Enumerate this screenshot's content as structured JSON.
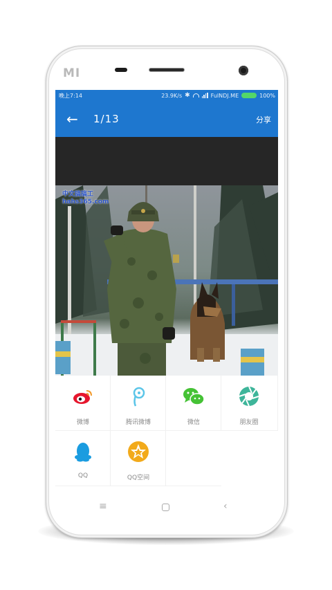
{
  "device": {
    "brand": "MI"
  },
  "status_bar": {
    "time": "晚上7:14",
    "speed": "23.9K/s",
    "carrier": "FulNDJ.ME",
    "battery": "100%"
  },
  "toolbar": {
    "back_icon": "arrow-left-icon",
    "counter": "1/13",
    "share_label": "分享"
  },
  "image": {
    "watermark_line1": "中文搞搞工",
    "watermark_line2": "hahs365.com"
  },
  "share_targets": [
    {
      "label": "微博",
      "icon": "weibo-icon",
      "color": "#e6162d"
    },
    {
      "label": "腾讯微博",
      "icon": "tencent-weibo-icon",
      "color": "#5bc5e8"
    },
    {
      "label": "微信",
      "icon": "wechat-icon",
      "color": "#45c235"
    },
    {
      "label": "朋友圈",
      "icon": "moments-icon",
      "color": "#3eb59a"
    },
    {
      "label": "QQ",
      "icon": "qq-icon",
      "color": "#1a9ce0"
    },
    {
      "label": "QQ空间",
      "icon": "qzone-icon",
      "color": "#f2aa1b"
    }
  ],
  "nav_bar": {
    "menu_icon": "menu-icon",
    "home_icon": "home-icon",
    "back_icon": "back-icon"
  },
  "colors": {
    "primary": "#1e77cf"
  }
}
